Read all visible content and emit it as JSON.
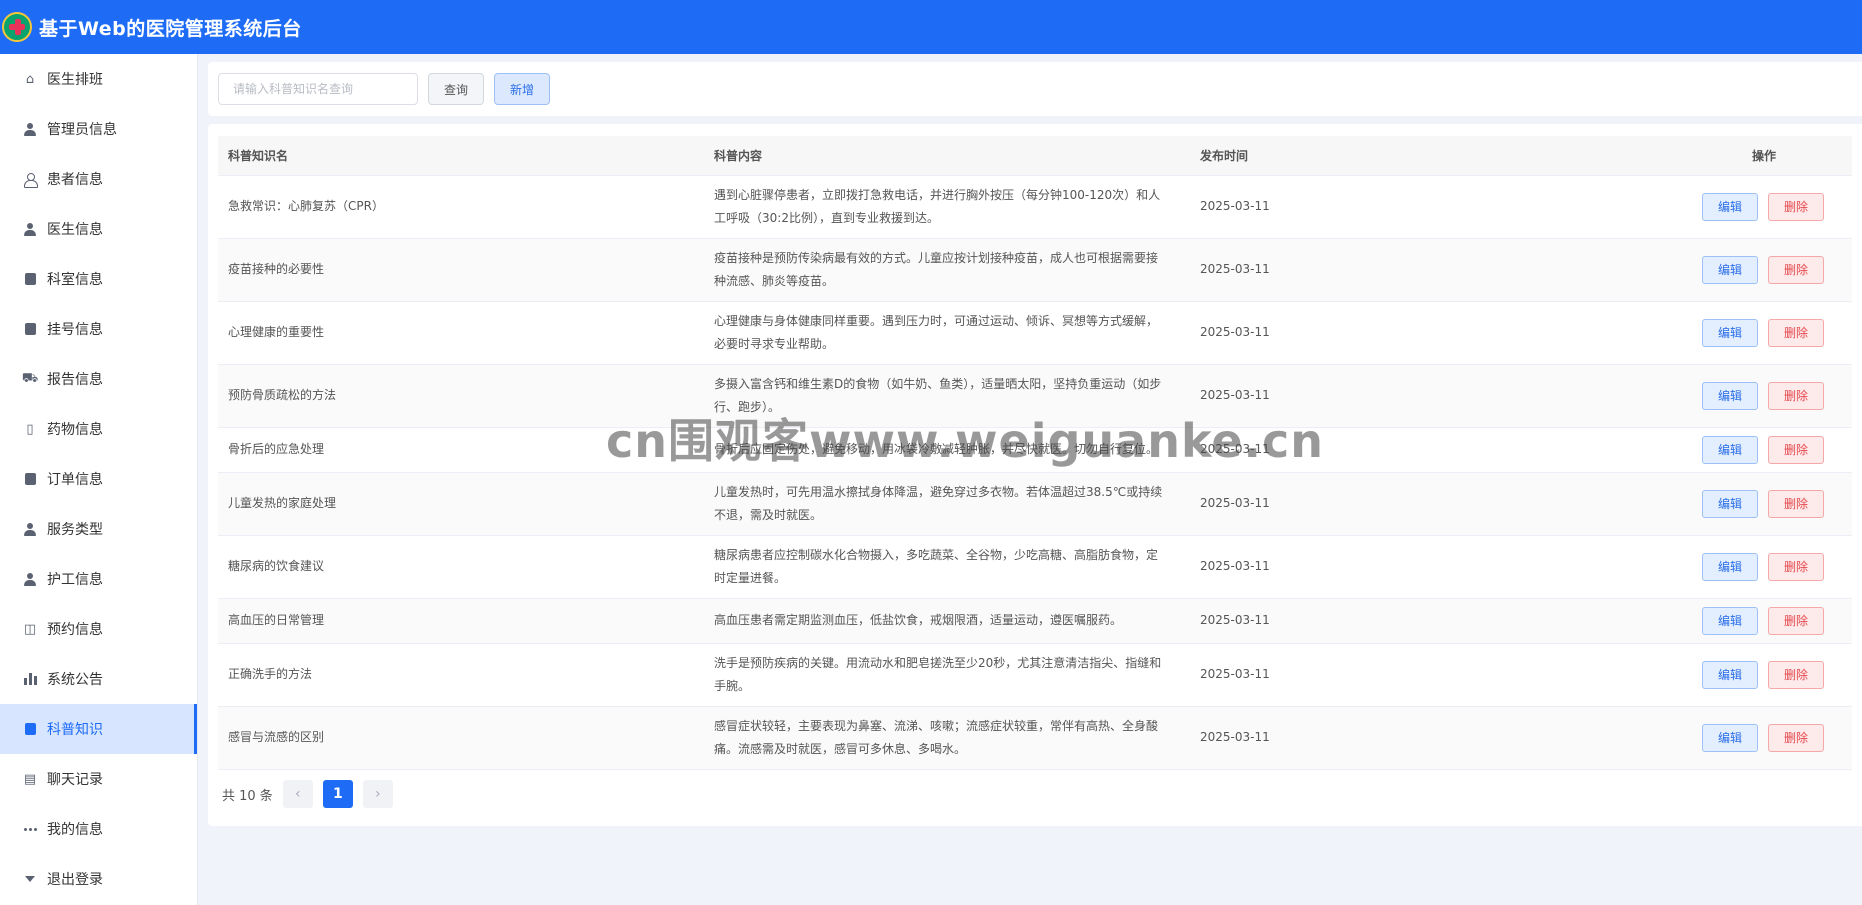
{
  "app": {
    "title": "基于Web的医院管理系统后台"
  },
  "sidebar": {
    "items": [
      {
        "label": "医生排班",
        "icon": "home-icon"
      },
      {
        "label": "管理员信息",
        "icon": "user-icon"
      },
      {
        "label": "患者信息",
        "icon": "user-outline-icon"
      },
      {
        "label": "医生信息",
        "icon": "user-icon"
      },
      {
        "label": "科室信息",
        "icon": "clipboard-icon"
      },
      {
        "label": "挂号信息",
        "icon": "bag-icon"
      },
      {
        "label": "报告信息",
        "icon": "truck-icon"
      },
      {
        "label": "药物信息",
        "icon": "note-icon"
      },
      {
        "label": "订单信息",
        "icon": "bag-icon"
      },
      {
        "label": "服务类型",
        "icon": "user-icon"
      },
      {
        "label": "护工信息",
        "icon": "user-icon"
      },
      {
        "label": "预约信息",
        "icon": "bag-outline-icon"
      },
      {
        "label": "系统公告",
        "icon": "bar-chart-icon"
      },
      {
        "label": "科普知识",
        "icon": "clipboard-icon",
        "active": true
      },
      {
        "label": "聊天记录",
        "icon": "chat-icon"
      },
      {
        "label": "我的信息",
        "icon": "more-dots-icon"
      },
      {
        "label": "退出登录",
        "icon": "caret-down-icon"
      }
    ]
  },
  "search": {
    "placeholder": "请输入科普知识名查询",
    "query_label": "查询",
    "add_label": "新增"
  },
  "table": {
    "headers": {
      "name": "科普知识名",
      "content": "科普内容",
      "time": "发布时间",
      "ops": "操作"
    },
    "edit_label": "编辑",
    "delete_label": "删除",
    "rows": [
      {
        "name": "急救常识：心肺复苏（CPR）",
        "content": "遇到心脏骤停患者，立即拨打急救电话，并进行胸外按压（每分钟100-120次）和人工呼吸（30:2比例），直到专业救援到达。",
        "time": "2025-03-11"
      },
      {
        "name": "疫苗接种的必要性",
        "content": "疫苗接种是预防传染病最有效的方式。儿童应按计划接种疫苗，成人也可根据需要接种流感、肺炎等疫苗。",
        "time": "2025-03-11"
      },
      {
        "name": "心理健康的重要性",
        "content": "心理健康与身体健康同样重要。遇到压力时，可通过运动、倾诉、冥想等方式缓解，必要时寻求专业帮助。",
        "time": "2025-03-11"
      },
      {
        "name": "预防骨质疏松的方法",
        "content": "多摄入富含钙和维生素D的食物（如牛奶、鱼类），适量晒太阳，坚持负重运动（如步行、跑步）。",
        "time": "2025-03-11"
      },
      {
        "name": "骨折后的应急处理",
        "content": "骨折后应固定伤处，避免移动，用冰袋冷敷减轻肿胀，并尽快就医。切勿自行复位。",
        "time": "2025-03-11"
      },
      {
        "name": "儿童发热的家庭处理",
        "content": "儿童发热时，可先用温水擦拭身体降温，避免穿过多衣物。若体温超过38.5℃或持续不退，需及时就医。",
        "time": "2025-03-11"
      },
      {
        "name": "糖尿病的饮食建议",
        "content": "糖尿病患者应控制碳水化合物摄入，多吃蔬菜、全谷物，少吃高糖、高脂肪食物，定时定量进餐。",
        "time": "2025-03-11"
      },
      {
        "name": "高血压的日常管理",
        "content": "高血压患者需定期监测血压，低盐饮食，戒烟限酒，适量运动，遵医嘱服药。",
        "time": "2025-03-11"
      },
      {
        "name": "正确洗手的方法",
        "content": "洗手是预防疾病的关键。用流动水和肥皂搓洗至少20秒，尤其注意清洁指尖、指缝和手腕。",
        "time": "2025-03-11"
      },
      {
        "name": "感冒与流感的区别",
        "content": "感冒症状较轻，主要表现为鼻塞、流涕、咳嗽；流感症状较重，常伴有高热、全身酸痛。流感需及时就医，感冒可多休息、多喝水。",
        "time": "2025-03-11"
      }
    ]
  },
  "pagination": {
    "total_text": "共 10 条",
    "current_page": "1",
    "prev": "‹",
    "next": "›"
  },
  "watermark": "cn围观客www.weiguanke.cn",
  "colors": {
    "primary": "#1e6cf5",
    "danger": "#e5484d",
    "active_bg": "#d7e5ff"
  }
}
